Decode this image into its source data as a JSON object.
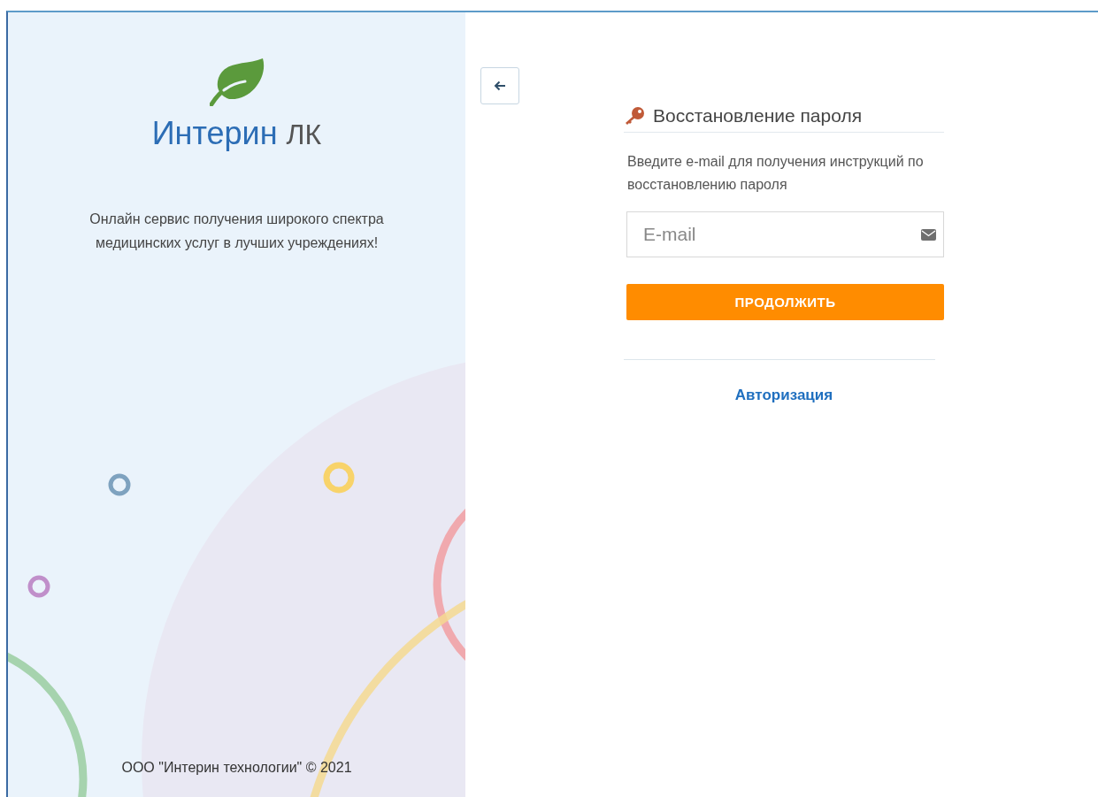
{
  "brand": {
    "name": "Интерин",
    "suffix": "ЛК"
  },
  "tagline": "Онлайн сервис получения широкого спектра медицинских услуг в лучших учреждениях!",
  "footer": "ООО \"Интерин технологии\" © 2021",
  "form": {
    "title": "Восстановление пароля",
    "description": "Введите e-mail для получения инструкций по восстановлению пароля",
    "email": {
      "placeholder": "E-mail"
    },
    "submit": "ПРОДОЛЖИТЬ",
    "link": "Авторизация"
  }
}
